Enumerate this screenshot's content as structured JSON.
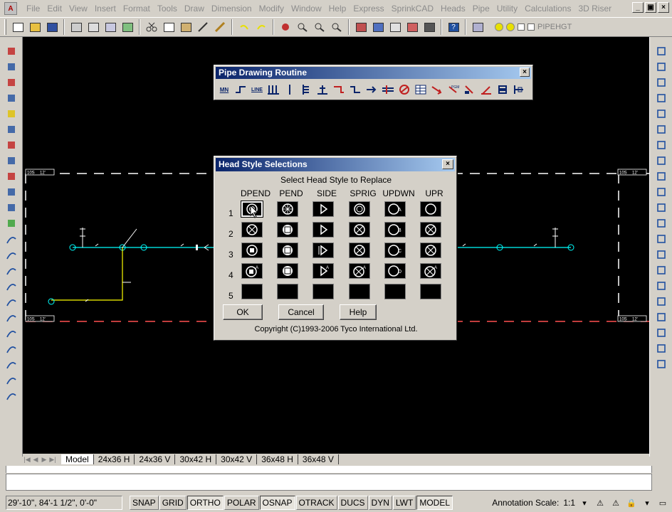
{
  "menu": [
    "File",
    "Edit",
    "View",
    "Insert",
    "Format",
    "Tools",
    "Draw",
    "Dimension",
    "Modify",
    "Window",
    "Help",
    "Express",
    "SprinkCAD",
    "Heads",
    "Pipe",
    "Utility",
    "Calculations",
    "3D Riser"
  ],
  "window_controls": [
    "_",
    "▣",
    "×"
  ],
  "layer": {
    "name": "PIPEHGT"
  },
  "pipe_toolbar": {
    "title": "Pipe Drawing Routine",
    "close": "×",
    "btn_mn": "MN",
    "btn_line": "LINE"
  },
  "dialog": {
    "title": "Head Style Selections",
    "close": "×",
    "subtitle": "Select Head Style to Replace",
    "columns": [
      "DPEND",
      "PEND",
      "SIDE",
      "SPRIG",
      "UPDWN",
      "UPR"
    ],
    "rows": [
      "1",
      "2",
      "3",
      "4",
      "5"
    ],
    "selected": {
      "row": 1,
      "column": "DPEND"
    },
    "ok": "OK",
    "cancel": "Cancel",
    "help": "Help",
    "copyright": "Copyright (C)1993-2006 Tyco International Ltd."
  },
  "drawing": {
    "border_labels": [
      "10S",
      "12'",
      "10S",
      "12'",
      "10S",
      "12'",
      "10S",
      "12'"
    ]
  },
  "layout_tabs": [
    "Model",
    "24x36 H",
    "24x36 V",
    "30x42 H",
    "30x42 V",
    "36x48 H",
    "36x48 V"
  ],
  "active_tab": "Model",
  "status": {
    "coords": "29'-10\",   84'-1 1/2\", 0'-0\"",
    "toggles": [
      {
        "label": "SNAP",
        "on": false
      },
      {
        "label": "GRID",
        "on": false
      },
      {
        "label": "ORTHO",
        "on": true
      },
      {
        "label": "POLAR",
        "on": false
      },
      {
        "label": "OSNAP",
        "on": true
      },
      {
        "label": "OTRACK",
        "on": false
      },
      {
        "label": "DUCS",
        "on": false
      },
      {
        "label": "DYN",
        "on": false
      },
      {
        "label": "LWT",
        "on": false
      },
      {
        "label": "MODEL",
        "on": true
      }
    ],
    "annotation_label": "Annotation Scale:",
    "annotation_value": "1:1"
  },
  "colors": {
    "canvas": "#000000",
    "pipe": "#00ffff",
    "branch": "#ffff00",
    "border_dash": "#ffffff",
    "red_line": "#ff0000",
    "title_bar": "#0a246a"
  }
}
